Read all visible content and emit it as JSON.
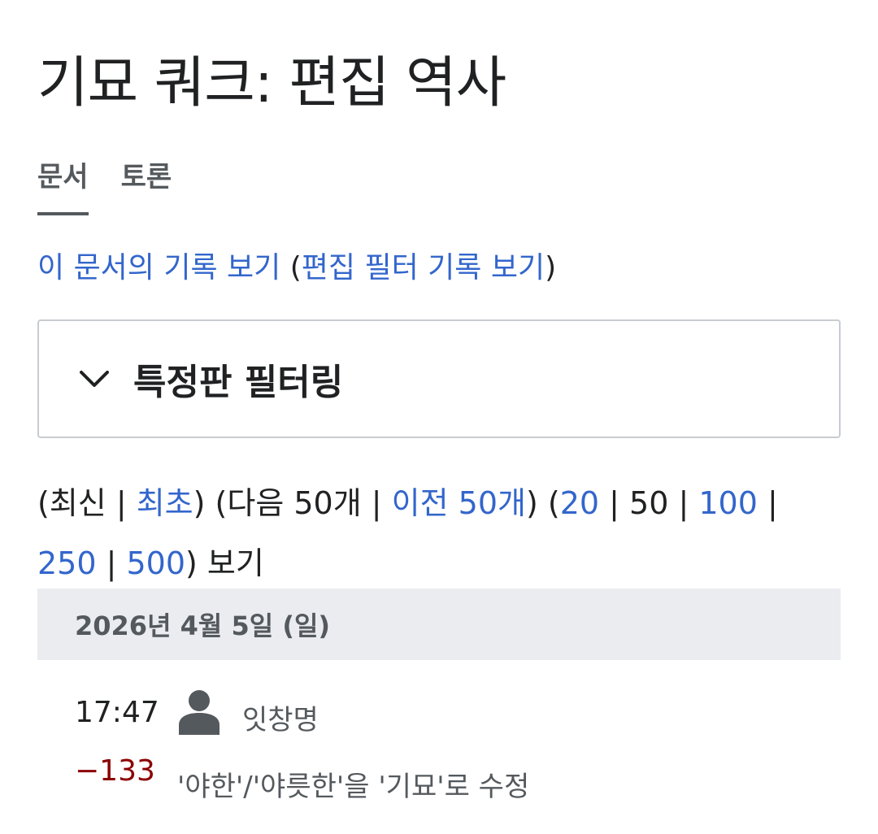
{
  "page_title": "기묘 쿼크: 편집 역사",
  "tabs": [
    {
      "label": "문서",
      "active": true
    },
    {
      "label": "토론",
      "active": false
    }
  ],
  "history_links": {
    "view_log": "이 문서의 기록 보기",
    "open_paren": " (",
    "filter_log": "편집 필터 기록 보기",
    "close_paren": ")"
  },
  "filter": {
    "label": "특정판 필터링",
    "icon": "chevron-down-icon",
    "expanded": false
  },
  "nav": {
    "t1": "(최신 | ",
    "oldest": "최초",
    "t2": ") (다음 50개 | ",
    "prev50": "이전 50개",
    "t3": ") (",
    "n20": "20",
    "t4": " | 50 | ",
    "n100": "100",
    "t5": " | ",
    "n250": "250",
    "t6": " | ",
    "n500": "500",
    "t7": ") 보기"
  },
  "date_header": "2026년 4월 5일 (일)",
  "entries": [
    {
      "time": "17:47",
      "user_icon": "user-icon",
      "user": "잇창명",
      "diff": "−133",
      "summary": "'야한'/'야릇한'을 '기묘'로 수정"
    }
  ],
  "colors": {
    "link": "#3366cc",
    "diff_negative": "#8b0000",
    "date_bg": "#eaecf0"
  }
}
